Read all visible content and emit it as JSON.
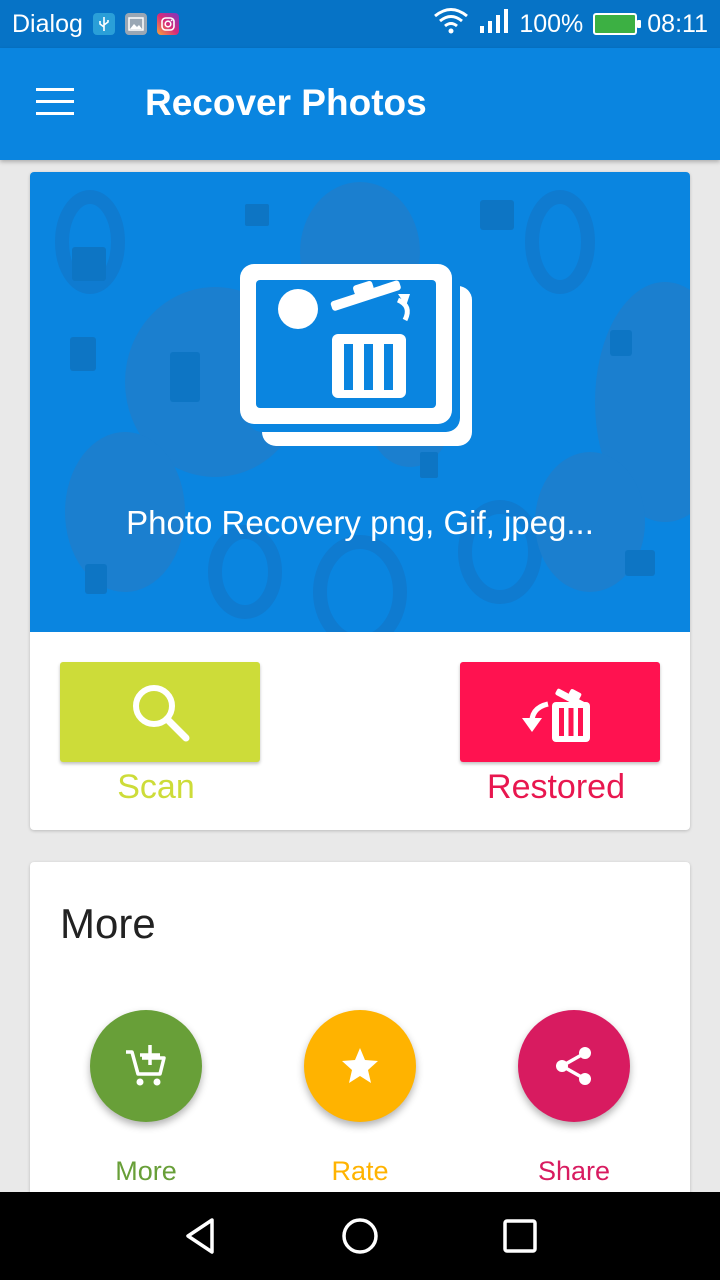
{
  "status_bar": {
    "carrier": "Dialog",
    "icons": [
      "usb-icon",
      "image-icon",
      "instagram-icon"
    ],
    "battery": "100%",
    "time": "08:11"
  },
  "app_bar": {
    "title": "Recover Photos",
    "menu_icon": "hamburger-menu-icon"
  },
  "hero": {
    "subtitle": "Photo Recovery png, Gif, jpeg...",
    "icon": "photo-recovery-trash-icon"
  },
  "actions": {
    "scan": {
      "label": "Scan",
      "icon": "search-icon",
      "color": "#cddc39"
    },
    "restored": {
      "label": "Restored",
      "icon": "restore-trash-icon",
      "color": "#ff1250"
    }
  },
  "more_section": {
    "heading": "More",
    "items": [
      {
        "label": "More",
        "icon": "add-cart-icon",
        "color": "#689f38"
      },
      {
        "label": "Rate",
        "icon": "star-icon",
        "color": "#ffb300"
      },
      {
        "label": "Share",
        "icon": "share-icon",
        "color": "#d81b60"
      }
    ]
  },
  "nav_bar": {
    "buttons": [
      "back-icon",
      "home-icon",
      "recents-icon"
    ]
  },
  "colors": {
    "primary": "#0a85e0",
    "status_bar": "#0673c6"
  }
}
